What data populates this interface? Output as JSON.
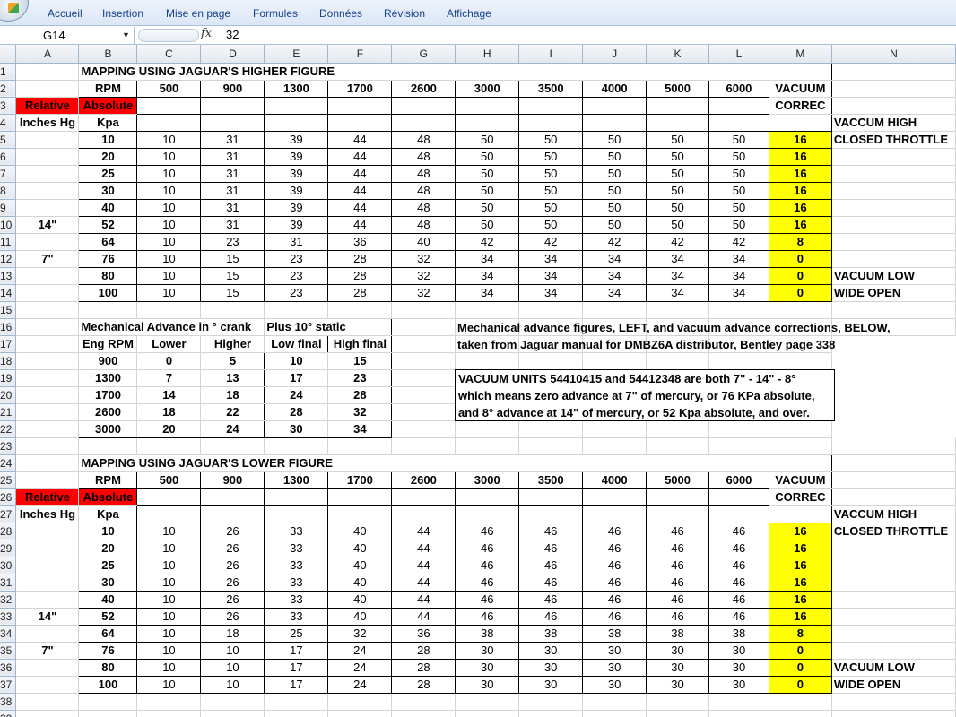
{
  "ribbon": {
    "tabs": [
      "Accueil",
      "Insertion",
      "Mise en page",
      "Formules",
      "Données",
      "Révision",
      "Affichage"
    ]
  },
  "formula_bar": {
    "cell": "G14",
    "fx": "fx",
    "value": "32"
  },
  "columns": [
    "A",
    "B",
    "C",
    "D",
    "E",
    "F",
    "G",
    "H",
    "I",
    "J",
    "K",
    "L",
    "M",
    "N"
  ],
  "rpm_headers": [
    "500",
    "900",
    "1300",
    "1700",
    "2600",
    "3000",
    "3500",
    "4000",
    "5000",
    "6000"
  ],
  "labels": {
    "rpm": "RPM",
    "relative": "Relative",
    "absolute": "Absolute",
    "inches_hg": "Inches Hg",
    "kpa": "Kpa",
    "vacuum": "VACUUM",
    "correc": "CORREC",
    "vaccum_high": "VACCUM HIGH",
    "closed_throttle": "CLOSED THROTTLE",
    "vacuum_low": "VACUUM LOW",
    "wide_open": "WIDE OPEN",
    "mark14": "14\"",
    "mark7": "7\""
  },
  "higher": {
    "title": "MAPPING USING JAGUAR'S HIGHER FIGURE",
    "rows": [
      {
        "kpa": "10",
        "vals": [
          "10",
          "31",
          "39",
          "44",
          "48",
          "50",
          "50",
          "50",
          "50",
          "50"
        ],
        "vac": "16"
      },
      {
        "kpa": "20",
        "vals": [
          "10",
          "31",
          "39",
          "44",
          "48",
          "50",
          "50",
          "50",
          "50",
          "50"
        ],
        "vac": "16"
      },
      {
        "kpa": "25",
        "vals": [
          "10",
          "31",
          "39",
          "44",
          "48",
          "50",
          "50",
          "50",
          "50",
          "50"
        ],
        "vac": "16"
      },
      {
        "kpa": "30",
        "vals": [
          "10",
          "31",
          "39",
          "44",
          "48",
          "50",
          "50",
          "50",
          "50",
          "50"
        ],
        "vac": "16"
      },
      {
        "kpa": "40",
        "vals": [
          "10",
          "31",
          "39",
          "44",
          "48",
          "50",
          "50",
          "50",
          "50",
          "50"
        ],
        "vac": "16"
      },
      {
        "kpa": "52",
        "vals": [
          "10",
          "31",
          "39",
          "44",
          "48",
          "50",
          "50",
          "50",
          "50",
          "50"
        ],
        "vac": "16"
      },
      {
        "kpa": "64",
        "vals": [
          "10",
          "23",
          "31",
          "36",
          "40",
          "42",
          "42",
          "42",
          "42",
          "42"
        ],
        "vac": "8"
      },
      {
        "kpa": "76",
        "vals": [
          "10",
          "15",
          "23",
          "28",
          "32",
          "34",
          "34",
          "34",
          "34",
          "34"
        ],
        "vac": "0"
      },
      {
        "kpa": "80",
        "vals": [
          "10",
          "15",
          "23",
          "28",
          "32",
          "34",
          "34",
          "34",
          "34",
          "34"
        ],
        "vac": "0"
      },
      {
        "kpa": "100",
        "vals": [
          "10",
          "15",
          "23",
          "28",
          "32",
          "34",
          "34",
          "34",
          "34",
          "34"
        ],
        "vac": "0"
      }
    ]
  },
  "lower": {
    "title": "MAPPING USING JAGUAR'S LOWER FIGURE",
    "rows": [
      {
        "kpa": "10",
        "vals": [
          "10",
          "26",
          "33",
          "40",
          "44",
          "46",
          "46",
          "46",
          "46",
          "46"
        ],
        "vac": "16"
      },
      {
        "kpa": "20",
        "vals": [
          "10",
          "26",
          "33",
          "40",
          "44",
          "46",
          "46",
          "46",
          "46",
          "46"
        ],
        "vac": "16"
      },
      {
        "kpa": "25",
        "vals": [
          "10",
          "26",
          "33",
          "40",
          "44",
          "46",
          "46",
          "46",
          "46",
          "46"
        ],
        "vac": "16"
      },
      {
        "kpa": "30",
        "vals": [
          "10",
          "26",
          "33",
          "40",
          "44",
          "46",
          "46",
          "46",
          "46",
          "46"
        ],
        "vac": "16"
      },
      {
        "kpa": "40",
        "vals": [
          "10",
          "26",
          "33",
          "40",
          "44",
          "46",
          "46",
          "46",
          "46",
          "46"
        ],
        "vac": "16"
      },
      {
        "kpa": "52",
        "vals": [
          "10",
          "26",
          "33",
          "40",
          "44",
          "46",
          "46",
          "46",
          "46",
          "46"
        ],
        "vac": "16"
      },
      {
        "kpa": "64",
        "vals": [
          "10",
          "18",
          "25",
          "32",
          "36",
          "38",
          "38",
          "38",
          "38",
          "38"
        ],
        "vac": "8"
      },
      {
        "kpa": "76",
        "vals": [
          "10",
          "10",
          "17",
          "24",
          "28",
          "30",
          "30",
          "30",
          "30",
          "30"
        ],
        "vac": "0"
      },
      {
        "kpa": "80",
        "vals": [
          "10",
          "10",
          "17",
          "24",
          "28",
          "30",
          "30",
          "30",
          "30",
          "30"
        ],
        "vac": "0"
      },
      {
        "kpa": "100",
        "vals": [
          "10",
          "10",
          "17",
          "24",
          "28",
          "30",
          "30",
          "30",
          "30",
          "30"
        ],
        "vac": "0"
      }
    ]
  },
  "mech": {
    "title": "Mechanical Advance in ° crank",
    "static_title": "Plus 10° static",
    "headers": [
      "Eng RPM",
      "Lower",
      "Higher",
      "Low final",
      "High final"
    ],
    "rows": [
      [
        "900",
        "0",
        "5",
        "10",
        "15"
      ],
      [
        "1300",
        "7",
        "13",
        "17",
        "23"
      ],
      [
        "1700",
        "14",
        "18",
        "24",
        "28"
      ],
      [
        "2600",
        "18",
        "22",
        "28",
        "32"
      ],
      [
        "3000",
        "20",
        "24",
        "30",
        "34"
      ]
    ]
  },
  "notes": {
    "line1": "Mechanical advance figures, LEFT, and vacuum advance corrections, BELOW,",
    "line2": "taken from Jaguar manual for DMBZ6A distributor, Bentley page 338",
    "vac1": "VACUUM UNITS 54410415 and 54412348 are both 7\" - 14\" - 8°",
    "vac2": "which means zero advance at 7\" of mercury, or 76 KPa absolute,",
    "vac3": "and 8° advance at 14\" of mercury, or 52 Kpa absolute, and over."
  }
}
